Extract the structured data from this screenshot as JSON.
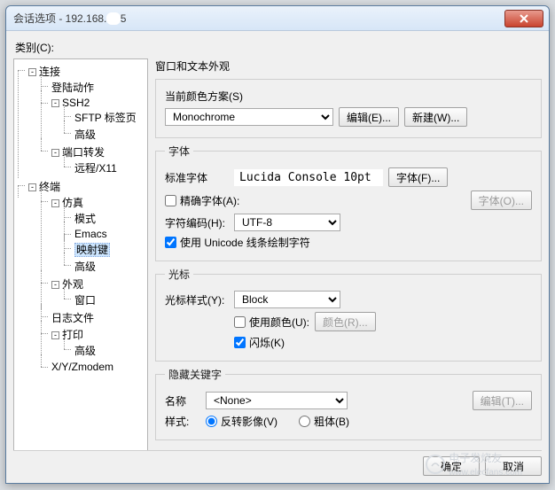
{
  "window": {
    "title": "会话选项 - 192.168.",
    "title_suffix": "5"
  },
  "category_label": "类别(C):",
  "tree": {
    "connection": "连接",
    "login_action": "登陆动作",
    "ssh2": "SSH2",
    "sftp_tab": "SFTP 标签页",
    "advanced1": "高级",
    "port_fwd": "端口转发",
    "remote_x11": "远程/X11",
    "terminal": "终端",
    "emulation": "仿真",
    "mode": "模式",
    "emacs": "Emacs",
    "mapkeys": "映射键",
    "advanced2": "高级",
    "appearance": "外观",
    "window": "窗口",
    "logfiles": "日志文件",
    "print": "打印",
    "advanced3": "高级",
    "xyz": "X/Y/Zmodem"
  },
  "panel": {
    "heading": "窗口和文本外观",
    "scheme_label": "当前颜色方案(S)",
    "scheme_value": "Monochrome",
    "edit_btn": "编辑(E)...",
    "new_btn": "新建(W)...",
    "font_section": "字体",
    "std_font_label": "标准字体",
    "std_font_value": "Lucida Console 10pt",
    "font_btn": "字体(F)...",
    "exact_font_chk": "精确字体(A):",
    "font_btn2": "字体(O)...",
    "charset_label": "字符编码(H):",
    "charset_value": "UTF-8",
    "unicode_chk": "使用 Unicode 线条绘制字符",
    "cursor_section": "光标",
    "cursor_style_label": "光标样式(Y):",
    "cursor_style_value": "Block",
    "use_color_chk": "使用颜色(U):",
    "color_btn": "颜色(R)...",
    "blink_chk": "闪烁(K)",
    "hide_section": "隐藏关键字",
    "name_label": "名称",
    "name_value": "<None>",
    "edit_btn2": "编辑(T)...",
    "style_label": "样式:",
    "style_invert": "反转影像(V)",
    "style_bold": "粗体(B)"
  },
  "buttons": {
    "ok": "确定",
    "cancel": "取消"
  },
  "watermark": "电子发烧友",
  "watermark_url": "www.elecfans.com"
}
